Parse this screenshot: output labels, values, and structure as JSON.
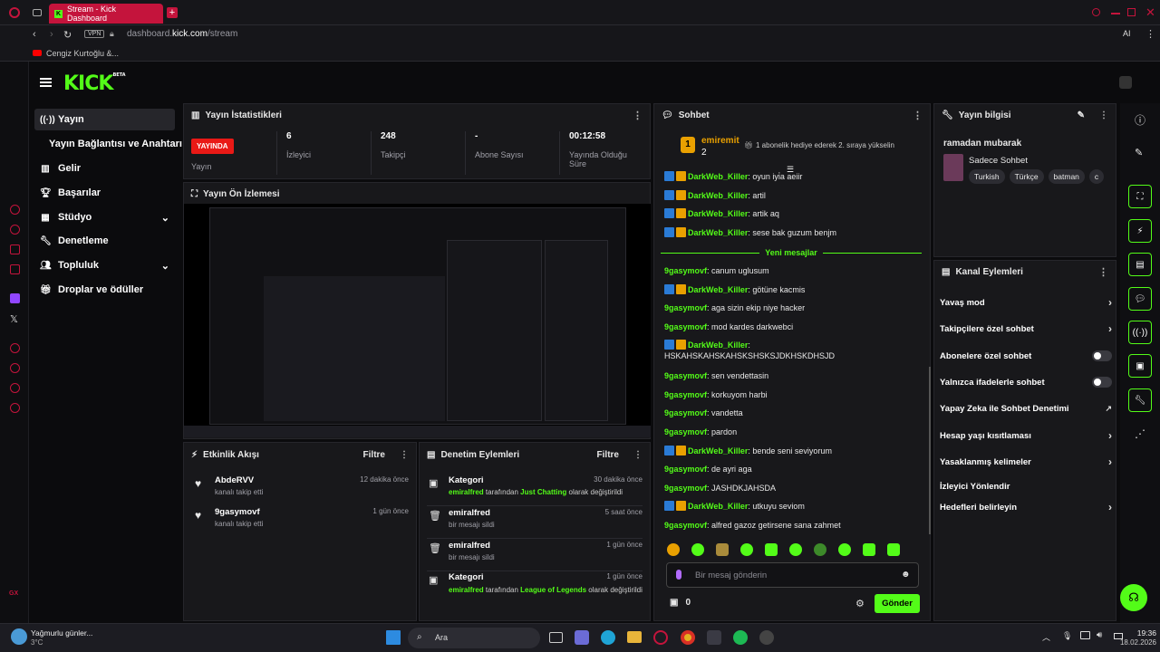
{
  "browser": {
    "tab_title": "Stream - Kick Dashboard",
    "vpn": "VPN",
    "url_prefix": "dashboard.",
    "url_host": "kick.com",
    "url_path": "/stream",
    "bookmark": "Cengiz Kurtoğlu &...",
    "ai_label": "AI"
  },
  "brand": {
    "logo": "KICK",
    "beta": "BETA",
    "green": "#53fc18",
    "red": "#e91916"
  },
  "nav": {
    "items": [
      {
        "label": "Yayın",
        "icon": "broadcast-icon"
      },
      {
        "label": "Yayın Bağlantısı ve Anahtarı",
        "icon": ""
      },
      {
        "label": "Gelir",
        "icon": "chart-icon"
      },
      {
        "label": "Başarılar",
        "icon": "trophy-icon"
      },
      {
        "label": "Stüdyo",
        "icon": "grid-icon"
      },
      {
        "label": "Denetleme",
        "icon": "wrench-icon"
      },
      {
        "label": "Topluluk",
        "icon": "people-icon"
      },
      {
        "label": "Droplar ve ödüller",
        "icon": "gift-icon"
      }
    ]
  },
  "stats": {
    "title": "Yayın İstatistikleri",
    "live_badge": "YAYINDA",
    "items": [
      {
        "value": "",
        "label": "Yayın"
      },
      {
        "value": "6",
        "label": "İzleyici"
      },
      {
        "value": "248",
        "label": "Takipçi"
      },
      {
        "value": "-",
        "label": "Abone Sayısı"
      },
      {
        "value": "00:12:58",
        "label": "Yayında Olduğu Süre"
      }
    ]
  },
  "preview": {
    "title": "Yayın Ön İzlemesi"
  },
  "activity": {
    "title": "Etkinlik Akışı",
    "filter": "Filtre",
    "rows": [
      {
        "name": "AbdeRVV",
        "desc": "kanalı takip etti",
        "time": "12 dakika önce"
      },
      {
        "name": "9gasymovf",
        "desc": "kanalı takip etti",
        "time": "1 gün önce"
      }
    ]
  },
  "moderation": {
    "title": "Denetim Eylemleri",
    "filter": "Filtre",
    "rows": [
      {
        "title": "Kategori",
        "actor": "emiralfred",
        "mid": " tarafından ",
        "target": "Just Chatting",
        "tail": " olarak değiştirildi",
        "time": "30 dakika önce"
      },
      {
        "title": "emiralfred",
        "desc": "bir mesajı sildi",
        "time": "5 saat önce"
      },
      {
        "title": "emiralfred",
        "desc": "bir mesajı sildi",
        "time": "1 gün önce"
      },
      {
        "title": "Kategori",
        "actor": "emiralfred",
        "mid": " tarafından ",
        "target": "League of Legends",
        "tail": " olarak değiştirildi",
        "time": "1 gün önce"
      }
    ]
  },
  "chat": {
    "title": "Sohbet",
    "pinned_user": "emiremit",
    "pinned_count": "2",
    "pinned_rank": "1",
    "pinned_text": "1 abonelik hediye ederek 2. sıraya yükselin",
    "new_messages": "Yeni mesajlar",
    "messages": [
      {
        "user": "DarkWeb_Killer",
        "text": "oyun iyi̇a aeiir",
        "mod": true
      },
      {
        "user": "DarkWeb_Killer",
        "text": "artil",
        "mod": true
      },
      {
        "user": "DarkWeb_Killer",
        "text": "artik aq",
        "mod": true
      },
      {
        "user": "DarkWeb_Killer",
        "text": "sese bak guzum benjm",
        "mod": true
      },
      {
        "user": "9gasymovf",
        "text": "canum uglusum",
        "mod": false
      },
      {
        "user": "DarkWeb_Killer",
        "text": "götüne kacmis",
        "mod": true
      },
      {
        "user": "9gasymovf",
        "text": "aga sizin ekip niye hacker",
        "mod": false
      },
      {
        "user": "9gasymovf",
        "text": "mod kardes darkwebci",
        "mod": false
      },
      {
        "user": "DarkWeb_Killer",
        "text": "HSKAHSKAHSKAHSKSHSKSJDKHSKDHSJD",
        "mod": true
      },
      {
        "user": "9gasymovf",
        "text": "sen vendettasin",
        "mod": false
      },
      {
        "user": "9gasymovf",
        "text": "korkuyom harbi",
        "mod": false
      },
      {
        "user": "9gasymovf",
        "text": "vandetta",
        "mod": false
      },
      {
        "user": "9gasymovf",
        "text": "pardon",
        "mod": false
      },
      {
        "user": "DarkWeb_Killer",
        "text": "bende seni seviyorum",
        "mod": true
      },
      {
        "user": "9gasymovf",
        "text": "de ayri aga",
        "mod": false
      },
      {
        "user": "9gasymovf",
        "text": "JASHDKJAHSDA",
        "mod": false
      },
      {
        "user": "DarkWeb_Killer",
        "text": "utkuyu seviom",
        "mod": true
      },
      {
        "user": "9gasymovf",
        "text": "alfred gazoz getirsene sana zahmet",
        "mod": false
      }
    ],
    "input_placeholder": "Bir mesaj gönderin",
    "points": "0",
    "send": "Gönder"
  },
  "stream_info": {
    "title": "Yayın bilgisi",
    "stream_title": "ramadan mubarak",
    "category": "Sadece Sohbet",
    "tags": [
      "Turkish",
      "Türkçe",
      "batman",
      "c"
    ]
  },
  "channel_actions": {
    "title": "Kanal Eylemleri",
    "rows": [
      {
        "label": "Yavaş mod",
        "control": "chevron"
      },
      {
        "label": "Takipçilere özel sohbet",
        "control": "chevron"
      },
      {
        "label": "Abonelere özel sohbet",
        "control": "toggle"
      },
      {
        "label": "Yalnızca ifadelerle sohbet",
        "control": "toggle"
      },
      {
        "label": "Yapay Zeka ile Sohbet Denetimi",
        "control": "external"
      },
      {
        "label": "Hesap yaşı kısıtlaması",
        "control": "chevron"
      },
      {
        "label": "Yasaklanmış kelimeler",
        "control": "chevron"
      },
      {
        "label": "İzleyici Yönlendir",
        "control": "none"
      },
      {
        "label": "Hedefleri belirleyin",
        "control": "chevron"
      }
    ]
  },
  "taskbar": {
    "weather_title": "Yağmurlu günler...",
    "weather_temp": "3°C",
    "search": "Ara",
    "time": "19:36",
    "date": "18.02.2026"
  },
  "opera_side_label": "GX"
}
